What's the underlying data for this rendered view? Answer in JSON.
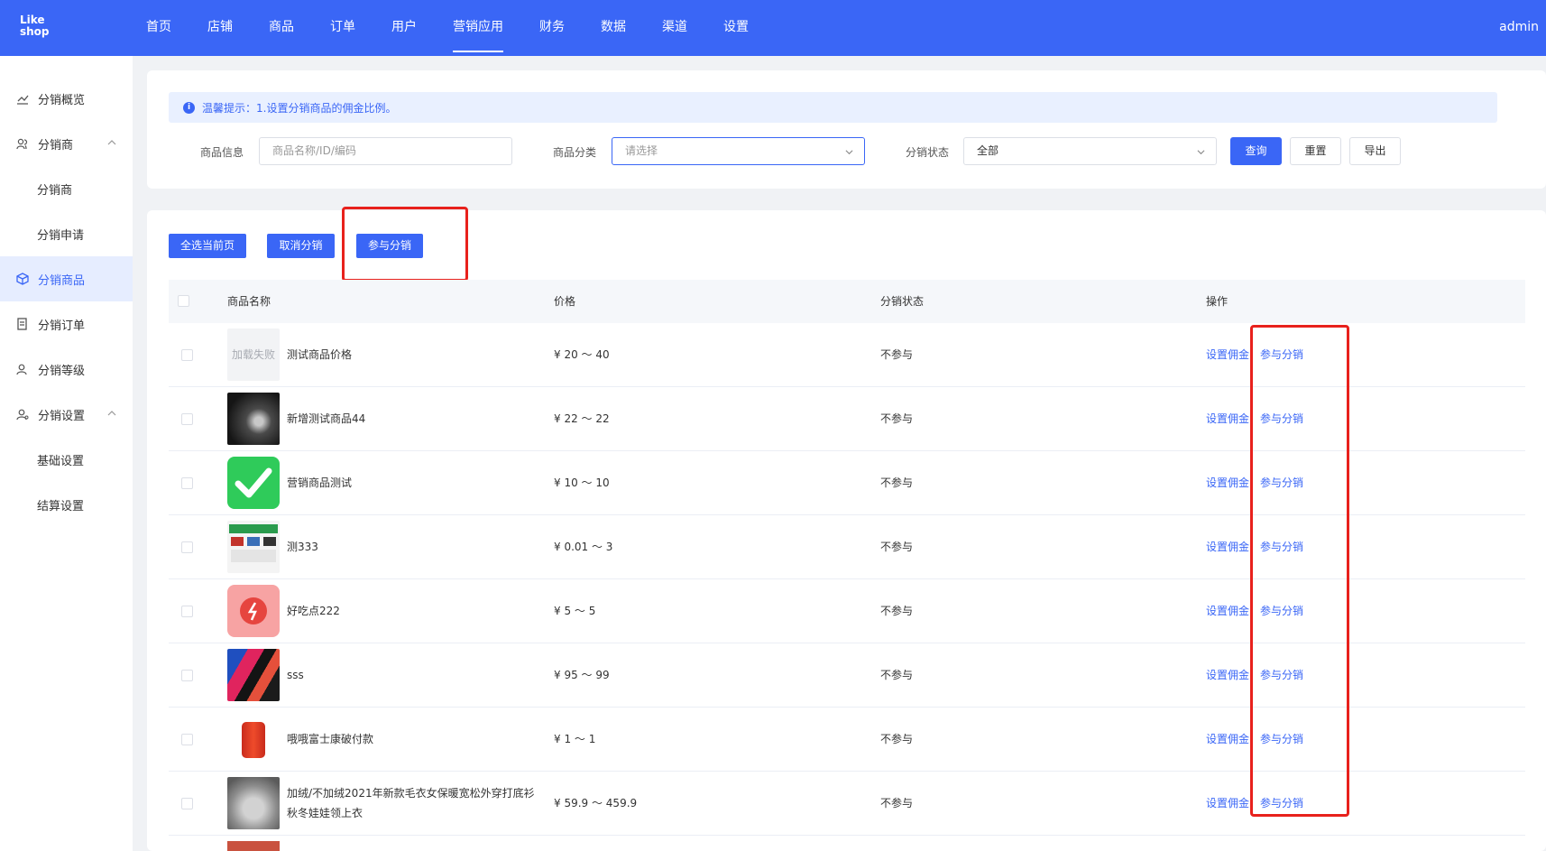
{
  "logo": {
    "line1": "Like",
    "line2": "shop"
  },
  "nav": [
    "首页",
    "店铺",
    "商品",
    "订单",
    "用户",
    "营销应用",
    "财务",
    "数据",
    "渠道",
    "设置"
  ],
  "nav_active": "营销应用",
  "user": "admin",
  "sidebar": [
    {
      "label": "分销概览",
      "icon": "chart-line-icon"
    },
    {
      "label": "分销商",
      "icon": "users-icon",
      "expand": true
    },
    {
      "label": "分销商",
      "sub": true
    },
    {
      "label": "分销申请",
      "sub": true
    },
    {
      "label": "分销商品",
      "icon": "box-icon",
      "active": true
    },
    {
      "label": "分销订单",
      "icon": "order-icon"
    },
    {
      "label": "分销等级",
      "icon": "user-level-icon"
    },
    {
      "label": "分销设置",
      "icon": "user-setting-icon",
      "expand": true
    },
    {
      "label": "基础设置",
      "sub": true
    },
    {
      "label": "结算设置",
      "sub": true
    }
  ],
  "tip": "温馨提示：1.设置分销商品的佣金比例。",
  "filters": {
    "product_info_label": "商品信息",
    "product_info_placeholder": "商品名称/ID/编码",
    "category_label": "商品分类",
    "category_placeholder": "请选择",
    "status_label": "分销状态",
    "status_value": "全部",
    "query": "查询",
    "reset": "重置",
    "export": "导出"
  },
  "toolbar": {
    "select_page": "全选当前页",
    "cancel": "取消分销",
    "join": "参与分销"
  },
  "table": {
    "headers": {
      "name": "商品名称",
      "price": "价格",
      "status": "分销状态",
      "action": "操作"
    },
    "action_commission": "设置佣金",
    "action_join": "参与分销",
    "rows": [
      {
        "name": "测试商品价格",
        "price": "¥ 20 ～ 40",
        "status": "不参与",
        "thumb": "fail",
        "thumb_text": "加载失败"
      },
      {
        "name": "新增测试商品44",
        "price": "¥ 22 ～ 22",
        "status": "不参与",
        "thumb": "dark"
      },
      {
        "name": "营销商品测试",
        "price": "¥ 10 ～ 10",
        "status": "不参与",
        "thumb": "check"
      },
      {
        "name": "测333",
        "price": "¥ 0.01 ～ 3",
        "status": "不参与",
        "thumb": "screens"
      },
      {
        "name": "好吃点222",
        "price": "¥ 5 ～ 5",
        "status": "不参与",
        "thumb": "alarm"
      },
      {
        "name": "sss",
        "price": "¥ 95 ～ 99",
        "status": "不参与",
        "thumb": "colors"
      },
      {
        "name": "哦哦富士康破付款",
        "price": "¥ 1 ～ 1",
        "status": "不参与",
        "thumb": "red"
      },
      {
        "name": "加绒/不加绒2021年新款毛衣女保暖宽松外穿打底衫秋冬娃娃领上衣",
        "price": "¥ 59.9 ～ 459.9",
        "status": "不参与",
        "thumb": "sweater"
      }
    ]
  },
  "colors": {
    "primary": "#3a66f6",
    "highlight": "#e8211c"
  }
}
